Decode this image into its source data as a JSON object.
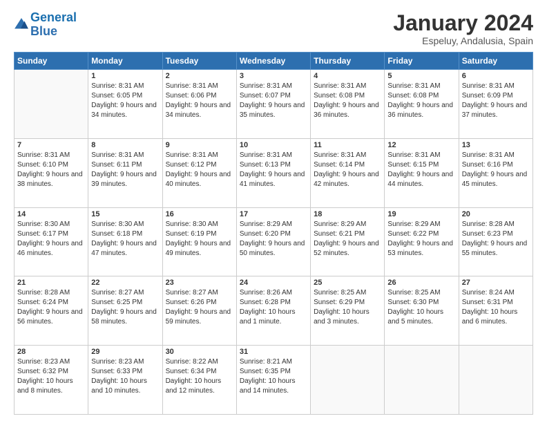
{
  "logo": {
    "line1": "General",
    "line2": "Blue"
  },
  "title": "January 2024",
  "location": "Espeluy, Andalusia, Spain",
  "weekdays": [
    "Sunday",
    "Monday",
    "Tuesday",
    "Wednesday",
    "Thursday",
    "Friday",
    "Saturday"
  ],
  "days": [
    {
      "num": "",
      "sunrise": "",
      "sunset": "",
      "daylight": ""
    },
    {
      "num": "1",
      "sunrise": "8:31 AM",
      "sunset": "6:05 PM",
      "daylight": "9 hours and 34 minutes."
    },
    {
      "num": "2",
      "sunrise": "8:31 AM",
      "sunset": "6:06 PM",
      "daylight": "9 hours and 34 minutes."
    },
    {
      "num": "3",
      "sunrise": "8:31 AM",
      "sunset": "6:07 PM",
      "daylight": "9 hours and 35 minutes."
    },
    {
      "num": "4",
      "sunrise": "8:31 AM",
      "sunset": "6:08 PM",
      "daylight": "9 hours and 36 minutes."
    },
    {
      "num": "5",
      "sunrise": "8:31 AM",
      "sunset": "6:08 PM",
      "daylight": "9 hours and 36 minutes."
    },
    {
      "num": "6",
      "sunrise": "8:31 AM",
      "sunset": "6:09 PM",
      "daylight": "9 hours and 37 minutes."
    },
    {
      "num": "7",
      "sunrise": "8:31 AM",
      "sunset": "6:10 PM",
      "daylight": "9 hours and 38 minutes."
    },
    {
      "num": "8",
      "sunrise": "8:31 AM",
      "sunset": "6:11 PM",
      "daylight": "9 hours and 39 minutes."
    },
    {
      "num": "9",
      "sunrise": "8:31 AM",
      "sunset": "6:12 PM",
      "daylight": "9 hours and 40 minutes."
    },
    {
      "num": "10",
      "sunrise": "8:31 AM",
      "sunset": "6:13 PM",
      "daylight": "9 hours and 41 minutes."
    },
    {
      "num": "11",
      "sunrise": "8:31 AM",
      "sunset": "6:14 PM",
      "daylight": "9 hours and 42 minutes."
    },
    {
      "num": "12",
      "sunrise": "8:31 AM",
      "sunset": "6:15 PM",
      "daylight": "9 hours and 44 minutes."
    },
    {
      "num": "13",
      "sunrise": "8:31 AM",
      "sunset": "6:16 PM",
      "daylight": "9 hours and 45 minutes."
    },
    {
      "num": "14",
      "sunrise": "8:30 AM",
      "sunset": "6:17 PM",
      "daylight": "9 hours and 46 minutes."
    },
    {
      "num": "15",
      "sunrise": "8:30 AM",
      "sunset": "6:18 PM",
      "daylight": "9 hours and 47 minutes."
    },
    {
      "num": "16",
      "sunrise": "8:30 AM",
      "sunset": "6:19 PM",
      "daylight": "9 hours and 49 minutes."
    },
    {
      "num": "17",
      "sunrise": "8:29 AM",
      "sunset": "6:20 PM",
      "daylight": "9 hours and 50 minutes."
    },
    {
      "num": "18",
      "sunrise": "8:29 AM",
      "sunset": "6:21 PM",
      "daylight": "9 hours and 52 minutes."
    },
    {
      "num": "19",
      "sunrise": "8:29 AM",
      "sunset": "6:22 PM",
      "daylight": "9 hours and 53 minutes."
    },
    {
      "num": "20",
      "sunrise": "8:28 AM",
      "sunset": "6:23 PM",
      "daylight": "9 hours and 55 minutes."
    },
    {
      "num": "21",
      "sunrise": "8:28 AM",
      "sunset": "6:24 PM",
      "daylight": "9 hours and 56 minutes."
    },
    {
      "num": "22",
      "sunrise": "8:27 AM",
      "sunset": "6:25 PM",
      "daylight": "9 hours and 58 minutes."
    },
    {
      "num": "23",
      "sunrise": "8:27 AM",
      "sunset": "6:26 PM",
      "daylight": "9 hours and 59 minutes."
    },
    {
      "num": "24",
      "sunrise": "8:26 AM",
      "sunset": "6:28 PM",
      "daylight": "10 hours and 1 minute."
    },
    {
      "num": "25",
      "sunrise": "8:25 AM",
      "sunset": "6:29 PM",
      "daylight": "10 hours and 3 minutes."
    },
    {
      "num": "26",
      "sunrise": "8:25 AM",
      "sunset": "6:30 PM",
      "daylight": "10 hours and 5 minutes."
    },
    {
      "num": "27",
      "sunrise": "8:24 AM",
      "sunset": "6:31 PM",
      "daylight": "10 hours and 6 minutes."
    },
    {
      "num": "28",
      "sunrise": "8:23 AM",
      "sunset": "6:32 PM",
      "daylight": "10 hours and 8 minutes."
    },
    {
      "num": "29",
      "sunrise": "8:23 AM",
      "sunset": "6:33 PM",
      "daylight": "10 hours and 10 minutes."
    },
    {
      "num": "30",
      "sunrise": "8:22 AM",
      "sunset": "6:34 PM",
      "daylight": "10 hours and 12 minutes."
    },
    {
      "num": "31",
      "sunrise": "8:21 AM",
      "sunset": "6:35 PM",
      "daylight": "10 hours and 14 minutes."
    }
  ],
  "labels": {
    "sunrise": "Sunrise:",
    "sunset": "Sunset:",
    "daylight": "Daylight:"
  }
}
